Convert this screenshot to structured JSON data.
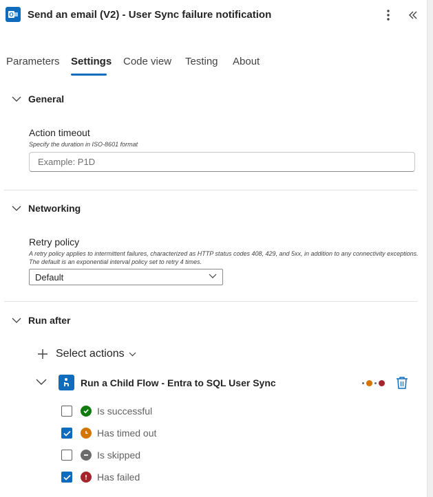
{
  "header": {
    "title": "Send an email (V2) - User Sync failure notification",
    "app_icon": "outlook-icon",
    "more_icon": "more-vertical-icon",
    "collapse_icon": "double-chevron-left-icon"
  },
  "tabs": [
    {
      "label": "Parameters",
      "active": false
    },
    {
      "label": "Settings",
      "active": true
    },
    {
      "label": "Code view",
      "active": false
    },
    {
      "label": "Testing",
      "active": false
    },
    {
      "label": "About",
      "active": false
    }
  ],
  "general": {
    "title": "General",
    "action_timeout": {
      "label": "Action timeout",
      "help": "Specify the duration in ISO-8601 format",
      "placeholder": "Example: P1D",
      "value": ""
    }
  },
  "networking": {
    "title": "Networking",
    "retry_policy": {
      "label": "Retry policy",
      "help": "A retry policy applies to intermittent failures, characterized as HTTP status codes 408, 429, and 5xx, in addition to any connectivity exceptions. The default is an exponential interval policy set to retry 4 times.",
      "selected": "Default"
    }
  },
  "run_after": {
    "title": "Run after",
    "select_actions_label": "Select actions",
    "action": {
      "title": "Run a Child Flow - Entra to SQL User Sync",
      "icon": "child-flow-icon",
      "status_dots": [
        "#d47500",
        "#a4262c"
      ]
    },
    "conditions": [
      {
        "label": "Is successful",
        "checked": false,
        "icon": "check-circle-icon",
        "color": "#107c10"
      },
      {
        "label": "Has timed out",
        "checked": true,
        "icon": "clock-icon",
        "color": "#d47500"
      },
      {
        "label": "Is skipped",
        "checked": false,
        "icon": "skip-circle-icon",
        "color": "#6b6b6b"
      },
      {
        "label": "Has failed",
        "checked": true,
        "icon": "error-circle-icon",
        "color": "#a4262c"
      }
    ]
  },
  "colors": {
    "accent": "#0f6cbd",
    "success": "#107c10",
    "warning": "#d47500",
    "error": "#a4262c",
    "neutral": "#6b6b6b"
  }
}
